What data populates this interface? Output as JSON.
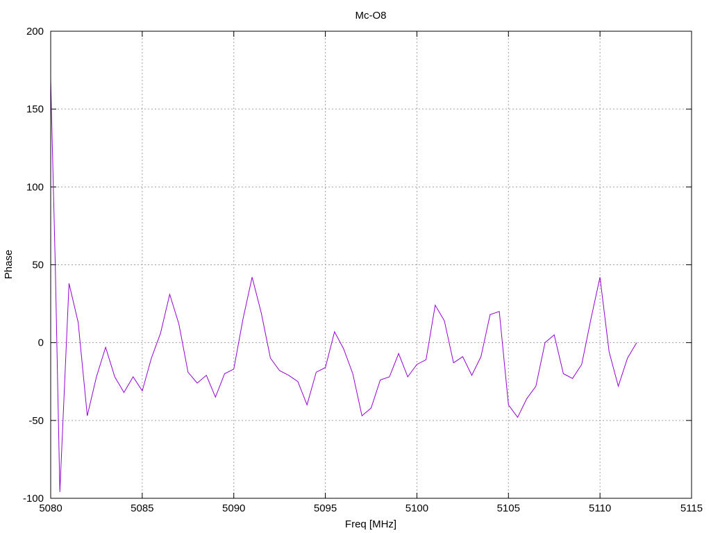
{
  "chart_data": {
    "type": "line",
    "title": "Mc-O8",
    "xlabel": "Freq [MHz]",
    "ylabel": "Phase",
    "xlim": [
      5080,
      5115
    ],
    "ylim": [
      -100,
      200
    ],
    "xticks": [
      5080,
      5085,
      5090,
      5095,
      5100,
      5105,
      5110,
      5115
    ],
    "yticks": [
      -100,
      -50,
      0,
      50,
      100,
      150,
      200
    ],
    "grid": true,
    "line_color": "#9400d3",
    "series": [
      {
        "x": [
          5080,
          5080.25,
          5080.5,
          5081,
          5081.5,
          5082,
          5082.5,
          5083,
          5083.5,
          5084,
          5084.5,
          5085,
          5085.5,
          5086,
          5086.5,
          5087,
          5087.5,
          5088,
          5088.5,
          5089,
          5089.5,
          5090,
          5090.5,
          5091,
          5091.5,
          5092,
          5092.5,
          5093,
          5093.5,
          5094,
          5094.5,
          5095,
          5095.5,
          5096,
          5096.5,
          5097,
          5097.5,
          5098,
          5098.5,
          5099,
          5099.5,
          5100,
          5100.5,
          5101,
          5101.5,
          5102,
          5102.5,
          5103,
          5103.5,
          5104,
          5104.5,
          5105,
          5105.5,
          5106,
          5106.5,
          5107,
          5107.5,
          5108,
          5108.5,
          5109,
          5109.5,
          5110,
          5110.5,
          5111,
          5111.5,
          5112
        ],
        "y": [
          169,
          50,
          -96,
          38,
          13,
          -47,
          -22,
          -3,
          -22,
          -32,
          -22,
          -31,
          -10,
          6,
          31,
          12,
          -19,
          -26,
          -21,
          -35,
          -20,
          -17,
          15,
          42,
          19,
          -10,
          -18,
          -21,
          -25,
          -40,
          -19,
          -16,
          7,
          -4,
          -20,
          -47,
          -42,
          -24,
          -22,
          -7,
          -22,
          -14,
          -11,
          24,
          14,
          -13,
          -9,
          -21,
          -9,
          18,
          20,
          -40,
          -48,
          -36,
          -28,
          0,
          5,
          -20,
          -23,
          -14,
          15,
          42,
          -6,
          -28,
          -10,
          0
        ]
      }
    ]
  }
}
